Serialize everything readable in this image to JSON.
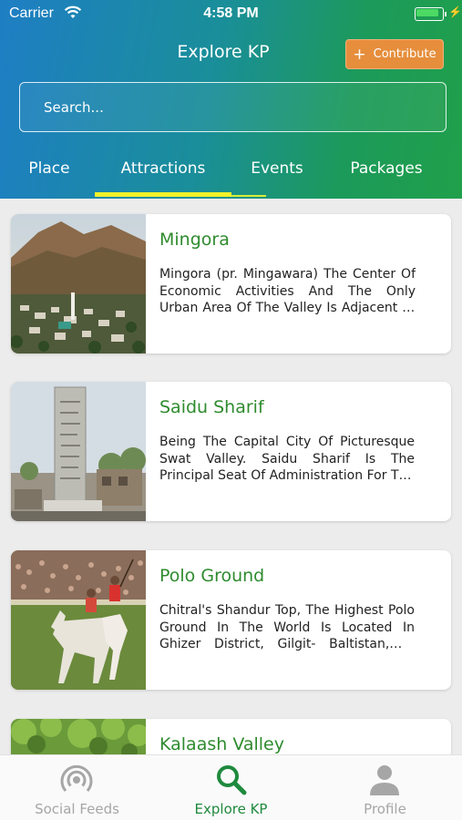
{
  "status_bar": {
    "carrier": "Carrier",
    "time": "4:58 PM"
  },
  "header": {
    "title": "Explore KP",
    "contribute_label": "Contribute",
    "search_placeholder": "Search..."
  },
  "tabs": [
    {
      "label": "Place"
    },
    {
      "label": "Attractions",
      "active": true
    },
    {
      "label": "Events"
    },
    {
      "label": "Packages"
    }
  ],
  "cards": [
    {
      "title": "Mingora",
      "description": "Mingora (pr. Mingawara) The Center Of Economic Activities And The Only Urban Area Of The Valley Is Adjacent To Saidu Sharif",
      "image_icon": "mountain-town-photo"
    },
    {
      "title": "Saidu Sharif",
      "description": "Being The Capital City Of Picturesque Swat Valley. Saidu Sharif Is The Principal Seat Of Administration For The District",
      "image_icon": "monument-photo"
    },
    {
      "title": "Polo Ground",
      "description": "Chitral's Shandur Top, The Highest Polo Ground In The World Is Located In Ghizer District, Gilgit- Baltistan, In Northern Pakistan",
      "image_icon": "polo-horses-photo"
    },
    {
      "title": "Kalaash Valley",
      "description": "",
      "image_icon": "green-valley-photo"
    }
  ],
  "tabbar": [
    {
      "label": "Social Feeds",
      "icon": "broadcast-icon"
    },
    {
      "label": "Explore KP",
      "icon": "search-icon",
      "active": true
    },
    {
      "label": "Profile",
      "icon": "person-icon"
    }
  ],
  "colors": {
    "accent_green": "#2e8b2e",
    "contribute_orange": "#e68e3c",
    "tab_indicator": "#f0f22a",
    "header_gradient_start": "#1e7ec4",
    "header_gradient_end": "#20a04a"
  }
}
